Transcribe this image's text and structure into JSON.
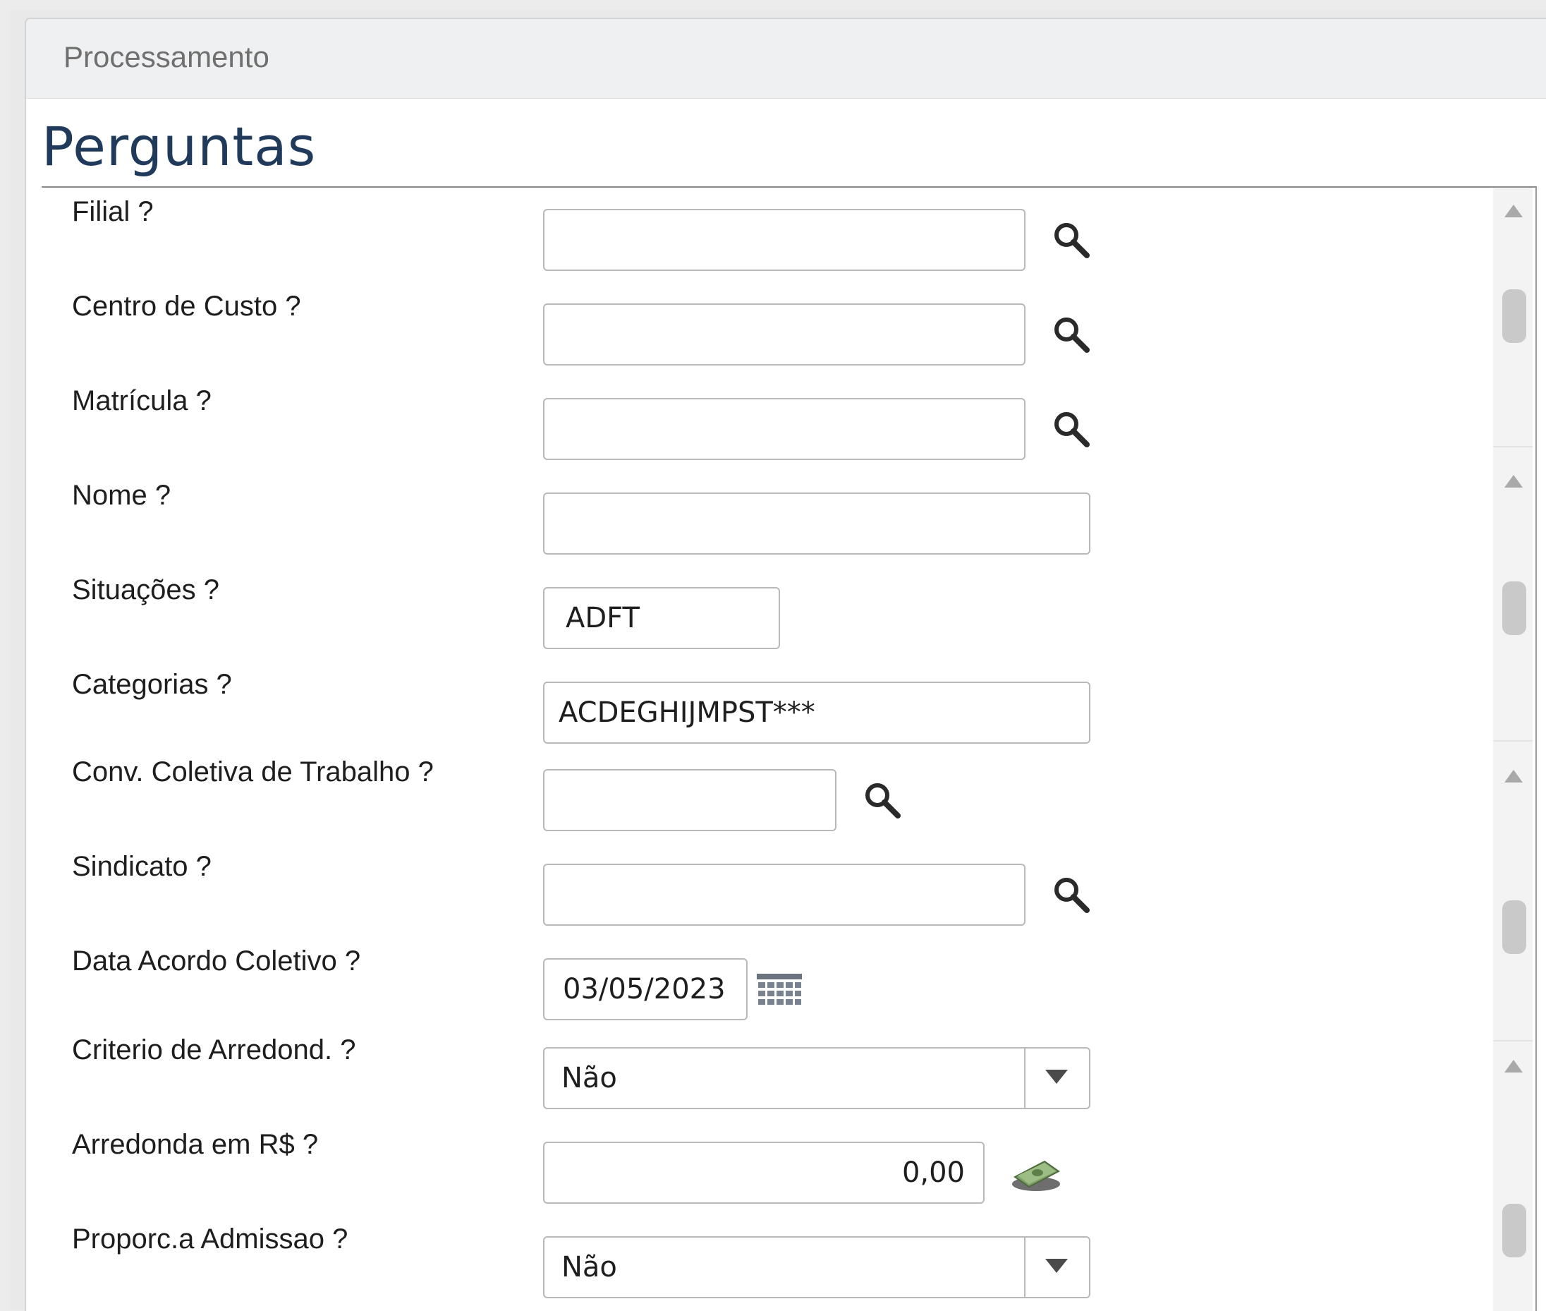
{
  "panel": {
    "header": "Processamento",
    "title": "Perguntas"
  },
  "questions": [
    {
      "label": "Filial ?",
      "value": "",
      "control": "lookup",
      "icon": "search-icon"
    },
    {
      "label": "Centro de Custo ?",
      "value": "",
      "control": "lookup",
      "icon": "search-icon"
    },
    {
      "label": "Matrícula ?",
      "value": "",
      "control": "lookup",
      "icon": "search-icon"
    },
    {
      "label": "Nome ?",
      "value": "",
      "control": "text"
    },
    {
      "label": "Situações ?",
      "value": "ADFT",
      "control": "text"
    },
    {
      "label": "Categorias ?",
      "value": "ACDEGHIJMPST***",
      "control": "text"
    },
    {
      "label": "Conv. Coletiva de Trabalho ?",
      "value": "",
      "control": "lookup",
      "icon": "search-icon"
    },
    {
      "label": "Sindicato ?",
      "value": "",
      "control": "lookup",
      "icon": "search-icon"
    },
    {
      "label": "Data Acordo Coletivo ?",
      "value": "03/05/2023",
      "control": "date",
      "icon": "calendar-icon"
    },
    {
      "label": "Criterio de Arredond. ?",
      "value": "Não",
      "control": "select",
      "icon": "chevron-down-icon"
    },
    {
      "label": "Arredonda em R$ ?",
      "value": "0,00",
      "control": "currency",
      "icon": "money-icon"
    },
    {
      "label": "Proporc.a Admissao ?",
      "value": "Não",
      "control": "select",
      "icon": "chevron-down-icon"
    }
  ],
  "colors": {
    "title": "#1f3a5a",
    "header_bg": "#eff0f2",
    "field_border": "#b9b9b9"
  }
}
